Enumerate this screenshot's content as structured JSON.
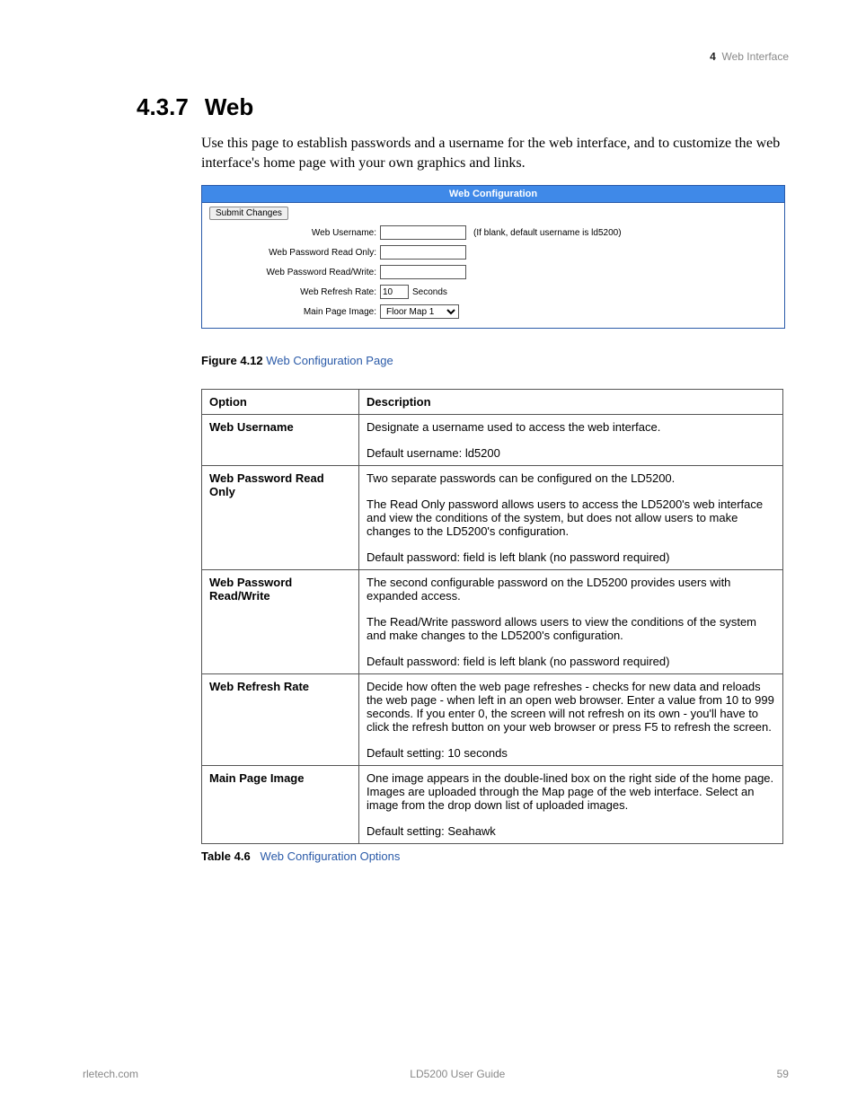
{
  "header": {
    "chapter_num": "4",
    "chapter_title": "Web Interface"
  },
  "section": {
    "number": "4.3.7",
    "title": "Web"
  },
  "intro": "Use this page to establish passwords and a username for the web interface, and to customize the web interface's home page with your own graphics and links.",
  "shot": {
    "title": "Web Configuration",
    "submit": "Submit Changes",
    "rows": {
      "username_label": "Web Username:",
      "username_value": "",
      "username_hint": "(If blank, default username is ld5200)",
      "pw_ro_label": "Web Password Read Only:",
      "pw_ro_value": "",
      "pw_rw_label": "Web Password Read/Write:",
      "pw_rw_value": "",
      "refresh_label": "Web Refresh Rate:",
      "refresh_value": "10",
      "refresh_unit": "Seconds",
      "main_img_label": "Main Page Image:",
      "main_img_value": "Floor Map 1"
    }
  },
  "figure": {
    "label": "Figure 4.12",
    "title": "Web Configuration Page"
  },
  "table": {
    "head_option": "Option",
    "head_desc": "Description",
    "rows": [
      {
        "name": "Web Username",
        "paras": [
          "Designate a username used to access the web interface.",
          "Default username: ld5200"
        ]
      },
      {
        "name": "Web Password Read Only",
        "paras": [
          "Two separate passwords can be configured on the LD5200.",
          "The Read Only password allows users to access the LD5200's web interface and view the conditions of the system, but does not allow users to make changes to the LD5200's configuration.",
          "Default password: field is left blank (no password required)"
        ]
      },
      {
        "name": "Web Password Read/Write",
        "paras": [
          "The second configurable password on the LD5200 provides users with expanded access.",
          "The Read/Write password allows users to view the conditions of the system and make changes to the LD5200's configuration.",
          "Default password: field is left blank (no password required)"
        ]
      },
      {
        "name": "Web Refresh Rate",
        "paras": [
          "Decide how often the web page refreshes - checks for new data and reloads the web page - when left in an open web browser. Enter a value from 10 to 999 seconds. If you enter 0, the screen will not refresh on its own - you'll have to click the refresh button on your web browser or press F5 to refresh the screen.",
          "Default setting: 10 seconds"
        ]
      },
      {
        "name": "Main Page Image",
        "paras": [
          "One image appears in the double-lined box on the right side of the home page. Images are uploaded through the Map page of the web interface. Select an image from the drop down list of uploaded images.",
          "Default setting: Seahawk"
        ]
      }
    ]
  },
  "tablecap": {
    "label": "Table 4.6",
    "title": "Web Configuration Options"
  },
  "footer": {
    "left": "rletech.com",
    "center": "LD5200 User Guide",
    "right": "59"
  }
}
